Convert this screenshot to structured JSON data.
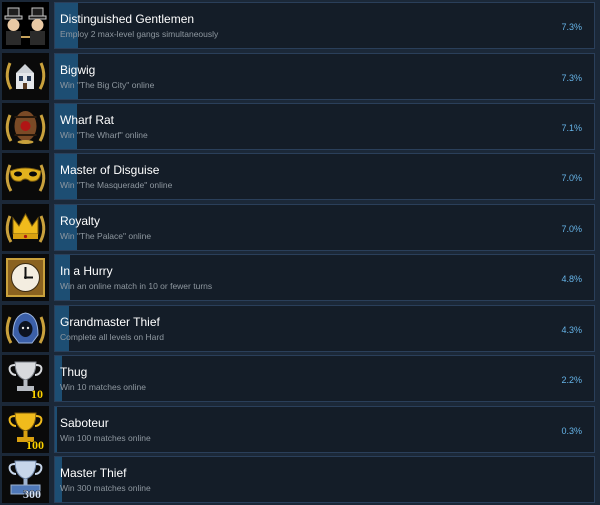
{
  "achievements": [
    {
      "title": "Distinguished Gentlemen",
      "description": "Employ 2 max-level gangs simultaneously",
      "percent_label": "7.3%",
      "percent": 7.3,
      "icon": "gentlemen-icon"
    },
    {
      "title": "Bigwig",
      "description": "Win \"The Big City\" online",
      "percent_label": "7.3%",
      "percent": 7.3,
      "icon": "mansion-icon"
    },
    {
      "title": "Wharf Rat",
      "description": "Win \"The Wharf\" online",
      "percent_label": "7.1%",
      "percent": 7.1,
      "icon": "barrel-icon"
    },
    {
      "title": "Master of Disguise",
      "description": "Win \"The Masquerade\" online",
      "percent_label": "7.0%",
      "percent": 7.0,
      "icon": "mask-icon"
    },
    {
      "title": "Royalty",
      "description": "Win \"The Palace\" online",
      "percent_label": "7.0%",
      "percent": 7.0,
      "icon": "crown-icon"
    },
    {
      "title": "In a Hurry",
      "description": "Win an online match in 10 or fewer turns",
      "percent_label": "4.8%",
      "percent": 4.8,
      "icon": "clock-icon"
    },
    {
      "title": "Grandmaster Thief",
      "description": "Complete all levels on Hard",
      "percent_label": "4.3%",
      "percent": 4.3,
      "icon": "hooded-thief-icon"
    },
    {
      "title": "Thug",
      "description": "Win 10 matches online",
      "percent_label": "2.2%",
      "percent": 2.2,
      "icon": "silver-trophy-icon",
      "badge": "10"
    },
    {
      "title": "Saboteur",
      "description": "Win 100 matches online",
      "percent_label": "0.3%",
      "percent": 0.3,
      "icon": "gold-trophy-icon",
      "badge": "100"
    },
    {
      "title": "Master Thief",
      "description": "Win 300 matches online",
      "percent_label": "",
      "percent": null,
      "icon": "platinum-trophy-icon",
      "badge": "300"
    }
  ],
  "colors": {
    "background": "#1b2838",
    "panel": "#141d28",
    "progress_fill": "#1d4e73",
    "percent_text": "#66b4e8",
    "title_text": "#ffffff",
    "description_text": "#8f98a0"
  }
}
